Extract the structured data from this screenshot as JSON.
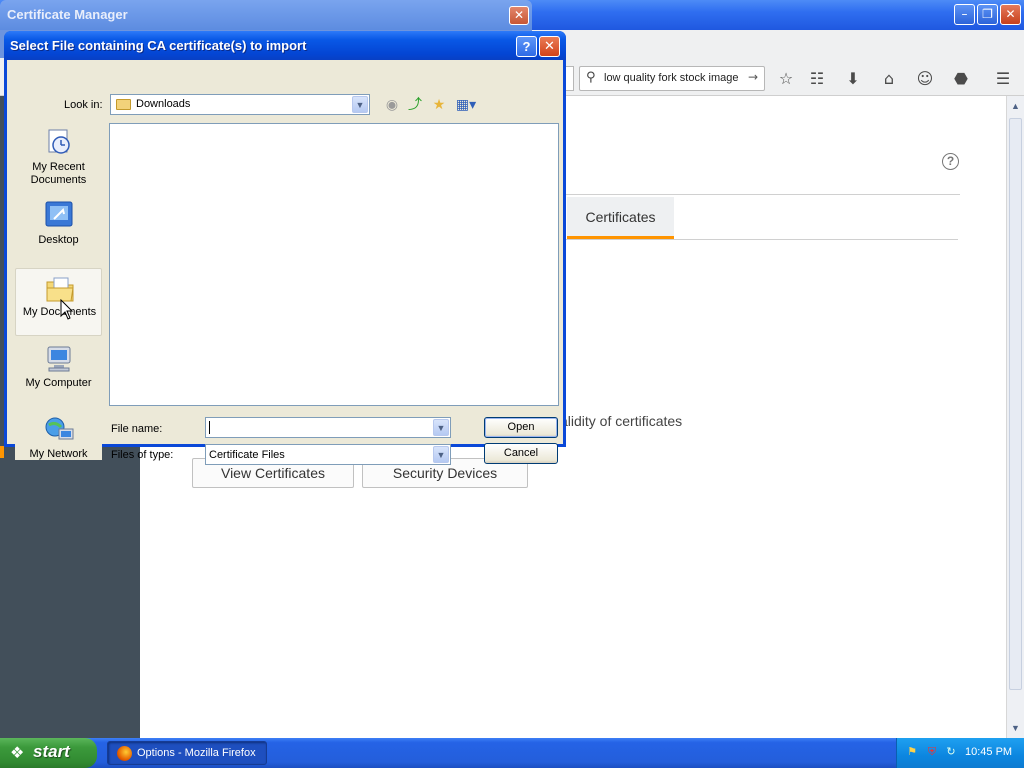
{
  "firefox": {
    "search_query": "low quality fork stock image",
    "toolbar_icons": [
      "star-icon",
      "reading-list-icon",
      "download-icon",
      "home-icon",
      "smiley-icon",
      "pocket-icon",
      "menu-icon"
    ],
    "tab_certificates": "Certificates",
    "validity_text": "alidity of certificates",
    "buttons": {
      "view_certificates": "View Certificates",
      "security_devices": "Security Devices"
    },
    "accent_color": "#ff9500"
  },
  "cert_manager": {
    "title": "Certificate Manager"
  },
  "dialog": {
    "title": "Select File containing CA certificate(s) to import",
    "look_in_label": "Look in:",
    "look_in_value": "Downloads",
    "places": [
      {
        "label": "My Recent Documents",
        "icon": "recent-documents-icon"
      },
      {
        "label": "Desktop",
        "icon": "desktop-icon"
      },
      {
        "label": "My Documents",
        "icon": "my-documents-icon"
      },
      {
        "label": "My Computer",
        "icon": "my-computer-icon"
      },
      {
        "label": "My Network",
        "icon": "my-network-icon"
      }
    ],
    "file_name_label": "File name:",
    "file_name_value": "",
    "files_of_type_label": "Files of type:",
    "files_of_type_value": "Certificate Files",
    "open_button": "Open",
    "cancel_button": "Cancel"
  },
  "taskbar": {
    "start_label": "start",
    "task_item": "Options - Mozilla Firefox",
    "clock": "10:45 PM"
  }
}
